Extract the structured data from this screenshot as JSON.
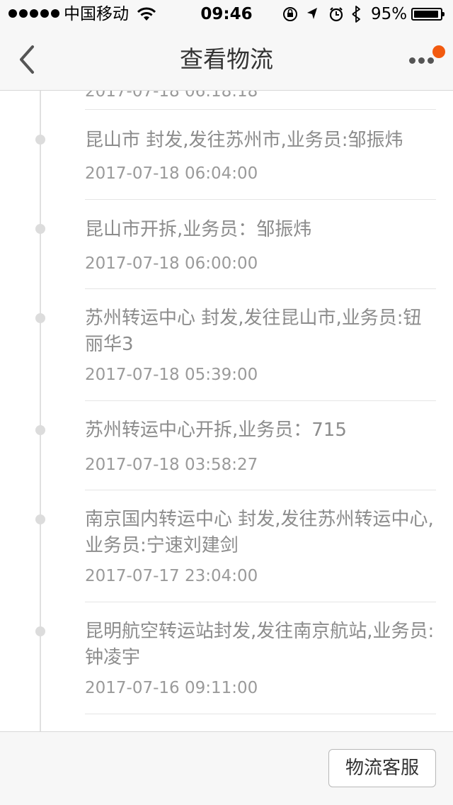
{
  "status_bar": {
    "carrier": "中国移动",
    "time": "09:46",
    "battery_percent": "95%",
    "battery_level": 0.95,
    "icons": [
      "signal-dots-icon",
      "wifi-icon",
      "rotation-lock-icon",
      "location-arrow-icon",
      "alarm-icon",
      "bluetooth-icon",
      "battery-icon"
    ]
  },
  "nav": {
    "title": "查看物流",
    "back_icon": "chevron-left-icon",
    "more_icon": "more-dots-icon",
    "badge_color": "#f25a0f"
  },
  "timeline": {
    "partial_time": "2017-07-18 06:18:18",
    "entries": [
      {
        "desc": "昆山市 封发,发往苏州市,业务员:邹振炜",
        "time": "2017-07-18 06:04:00"
      },
      {
        "desc": "昆山市开拆,业务员：邹振炜",
        "time": "2017-07-18 06:00:00"
      },
      {
        "desc": "苏州转运中心 封发,发往昆山市,业务员:钮丽华3",
        "time": "2017-07-18 05:39:00"
      },
      {
        "desc": "苏州转运中心开拆,业务员：715",
        "time": "2017-07-18 03:58:27"
      },
      {
        "desc": "南京国内转运中心 封发,发往苏州转运中心,业务员:宁速刘建剑",
        "time": "2017-07-17 23:04:00"
      },
      {
        "desc": "昆明航空转运站封发,发往南京航站,业务员:钟凌宇",
        "time": "2017-07-16 09:11:00"
      }
    ]
  },
  "bottom": {
    "service_button": "物流客服"
  }
}
